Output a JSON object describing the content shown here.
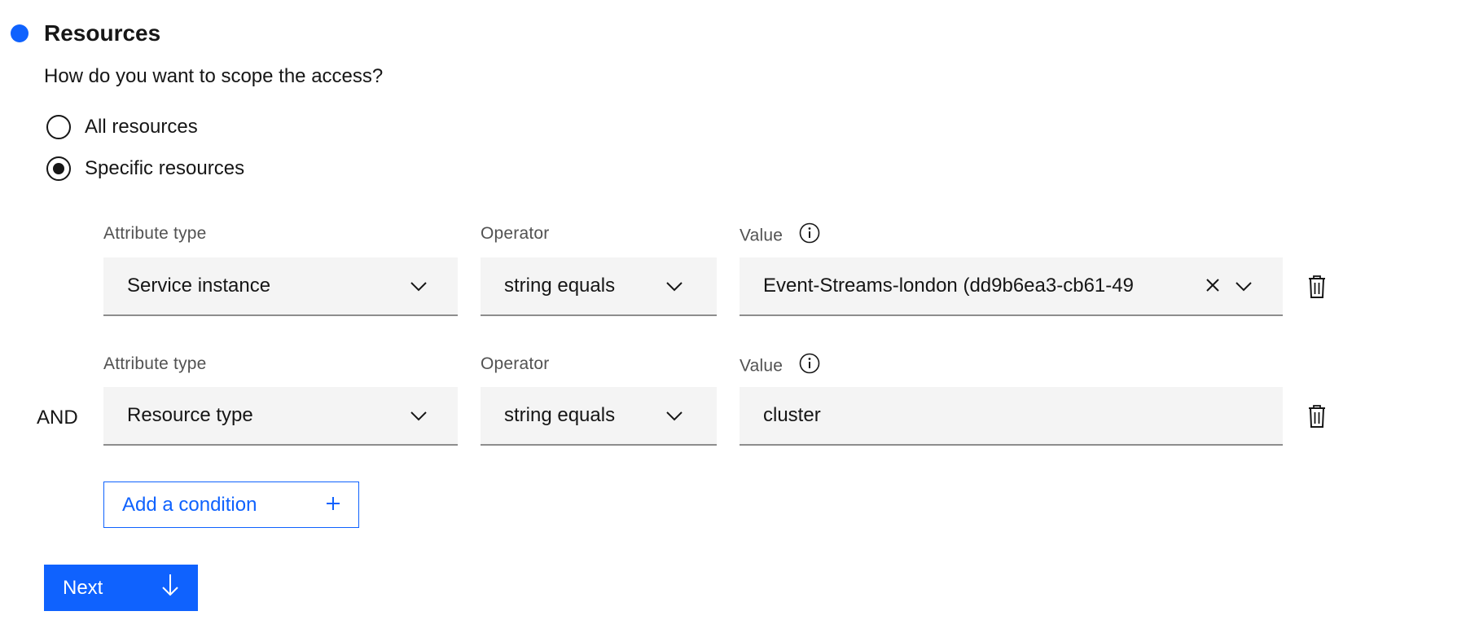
{
  "section": {
    "title": "Resources",
    "question": "How do you want to scope the access?",
    "accent_color": "#0f62fe"
  },
  "scope_options": [
    {
      "label": "All resources",
      "selected": false
    },
    {
      "label": "Specific resources",
      "selected": true
    }
  ],
  "conditions": [
    {
      "attribute_label": "Attribute type",
      "attribute_value": "Service instance",
      "operator_label": "Operator",
      "operator_value": "string equals",
      "value_label": "Value",
      "value": "Event-Streams-london (dd9b6ea3-cb61-49"
    },
    {
      "connector": "AND",
      "attribute_label": "Attribute type",
      "attribute_value": "Resource type",
      "operator_label": "Operator",
      "operator_value": "string equals",
      "value_label": "Value",
      "value": "cluster"
    }
  ],
  "buttons": {
    "add_condition": "Add a condition",
    "next": "Next"
  },
  "icons": {
    "info": "info-icon",
    "chevron": "chevron-down-icon",
    "clear": "close-icon",
    "delete": "trash-icon",
    "add": "plus-icon",
    "next": "arrow-down-icon"
  }
}
